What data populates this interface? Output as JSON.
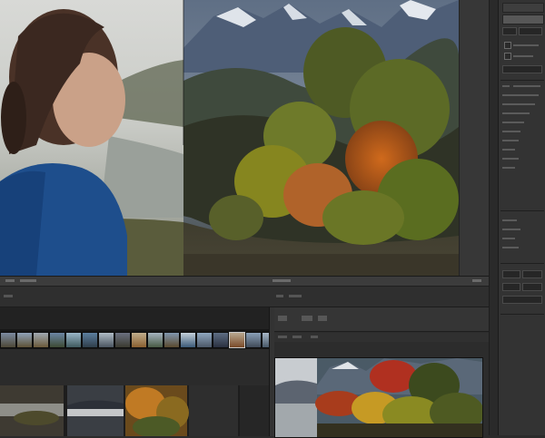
{
  "app": {
    "window": "photo-editor"
  },
  "viewport": {
    "image": "landscape-photo"
  },
  "filmstrip": {
    "thumbnail_count": 17,
    "selected_index": 15
  },
  "properties_panel": {
    "sections": 3
  },
  "colors": {
    "panel_bg": "#333333",
    "workspace_bg": "#262626",
    "film_bg": "#171717",
    "accent_selected": "#c8c8c8"
  },
  "icons": {
    "collapse": "chevron-icon",
    "panel_menu": "menu-icon"
  }
}
